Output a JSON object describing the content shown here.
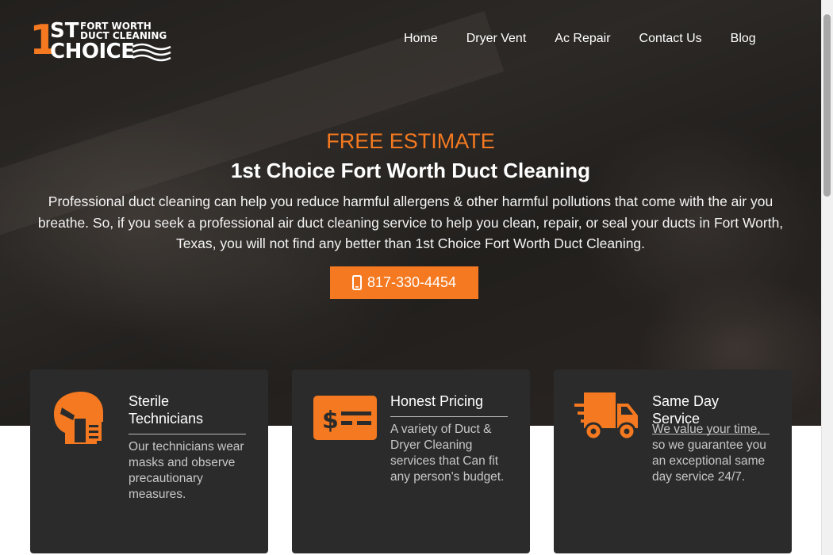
{
  "logo": {
    "one": "1",
    "st": "ST",
    "line1": "FORT WORTH",
    "line2": "DUCT CLEANING",
    "choice": "CHOICE"
  },
  "nav": {
    "items": [
      "Home",
      "Dryer Vent",
      "Ac Repair",
      "Contact Us",
      "Blog"
    ]
  },
  "hero": {
    "kicker": "FREE ESTIMATE",
    "title": "1st Choice Fort Worth Duct Cleaning",
    "description": "Professional duct cleaning can help you reduce harmful allergens & other harmful pollutions that come with the air you breathe. So, if you seek a professional air duct cleaning service to help you clean, repair, or seal your ducts in Fort Worth, Texas, you will not find any better than 1st Choice Fort Worth Duct Cleaning.",
    "phone_label": "817-330-4454"
  },
  "cards": [
    {
      "title": "Sterile Technicians",
      "text": "Our technicians wear masks and observe precautionary measures.",
      "icon": "masked-technician-icon"
    },
    {
      "title": "Honest Pricing",
      "text": "A variety of Duct & Dryer Cleaning services that Can fit any person's budget.",
      "icon": "price-tag-icon"
    },
    {
      "title": "Same Day Service",
      "text": "We value your time, so we guarantee you an exceptional same day service 24/7.",
      "icon": "delivery-truck-icon"
    }
  ],
  "colors": {
    "accent": "#f47920",
    "card_bg": "#2b2b2b",
    "hero_text": "#ffffff"
  }
}
